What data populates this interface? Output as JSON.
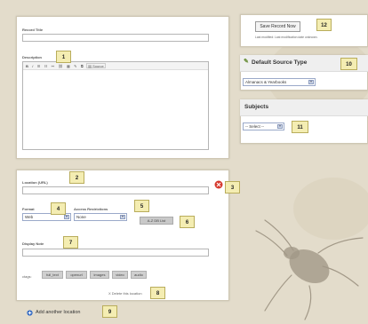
{
  "record_title": {
    "label": "Record Title"
  },
  "description": {
    "label": "Description",
    "toolbar": [
      "B",
      "I",
      "☰",
      "☷",
      "⚯",
      "⛓",
      "▦",
      "✎",
      "⧉"
    ],
    "source_label": "Source"
  },
  "location": {
    "label": "Location (URL)",
    "remove_icon": "remove-circle-icon"
  },
  "format": {
    "label": "Format",
    "selected": "Web"
  },
  "access": {
    "label": "Access Restrictions",
    "selected": "None",
    "az_button": "A-Z DB List"
  },
  "display_note": {
    "label": "Display Note"
  },
  "tags": {
    "label": "ctags:",
    "items": [
      "full_text",
      "openurl",
      "images",
      "video",
      "audio"
    ]
  },
  "delete_link": "X Delete this location",
  "add_location": "Add another location",
  "save": {
    "button": "Save Record Now",
    "status": "Last modified: Last modification date unknown."
  },
  "default_source": {
    "title": "Default Source Type",
    "selected": "Almanacs & Yearbooks"
  },
  "subjects": {
    "title": "Subjects",
    "selected": "-- Select --"
  },
  "callouts": [
    "1",
    "2",
    "3",
    "4",
    "5",
    "6",
    "7",
    "8",
    "9",
    "10",
    "11",
    "12"
  ],
  "colors": {
    "background": "#e3dccb",
    "callout": "#f4edb2",
    "select_border": "#9aa9c9",
    "remove_red": "#d63a2e",
    "add_blue": "#3a6fc4"
  }
}
